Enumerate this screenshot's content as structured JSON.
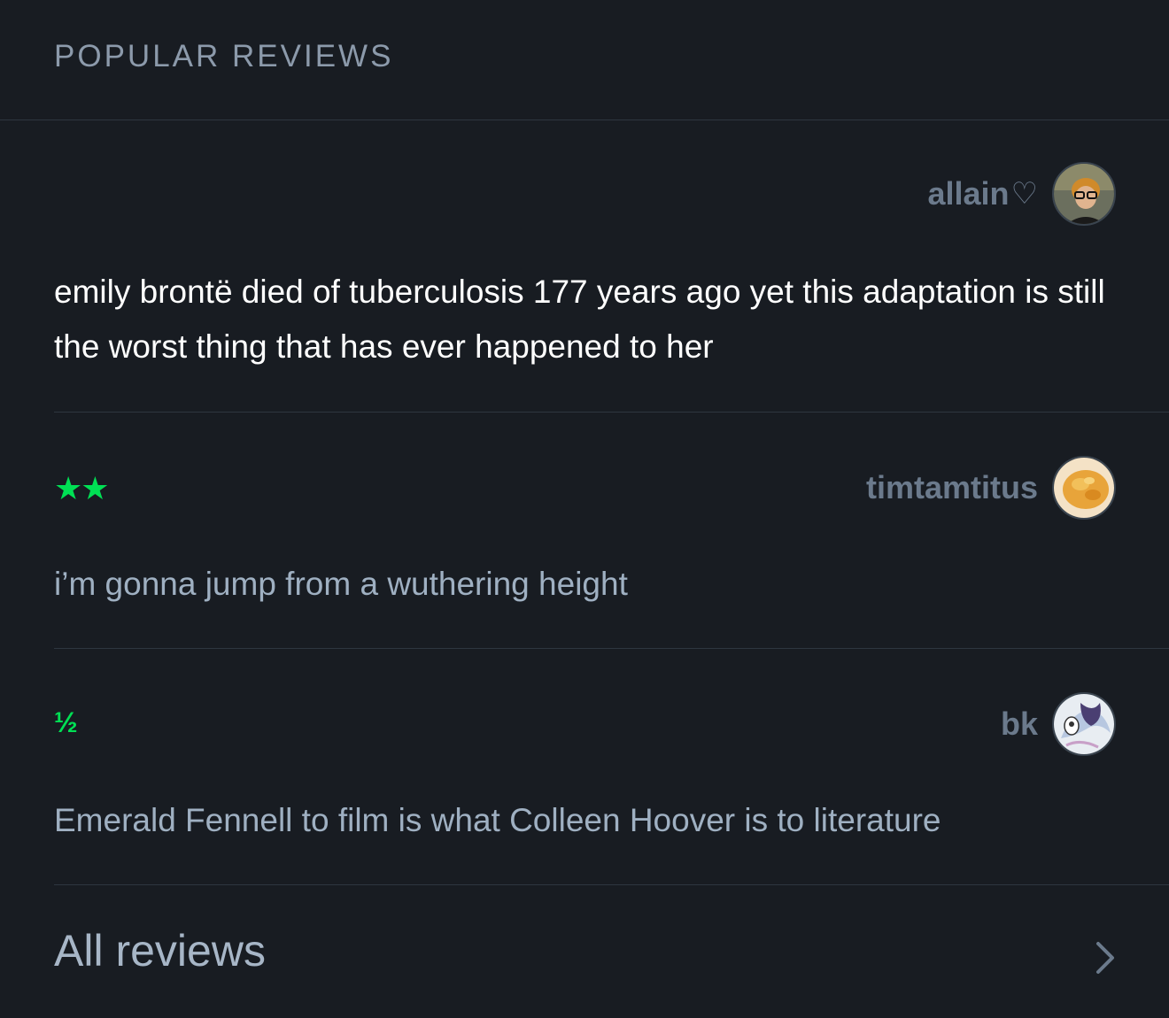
{
  "section": {
    "title": "POPULAR REVIEWS"
  },
  "reviews": [
    {
      "author": "allain",
      "heart": "♡",
      "rating": "",
      "text": "emily brontë died of tuberculosis 177 years ago yet this adaptation is still the worst thing that has ever happened to her"
    },
    {
      "author": "timtamtitus",
      "rating": "★★",
      "rating_value": 2,
      "text": "i’m gonna jump from a wuthering height"
    },
    {
      "author": "bk",
      "rating": "½",
      "rating_value": 0.5,
      "text": "Emerald Fennell to film is what Colleen Hoover is to literature"
    }
  ],
  "footer": {
    "all_reviews_label": "All reviews"
  },
  "colors": {
    "background": "#181c22",
    "star_green": "#00e054",
    "author_gray": "#6b7a8c"
  }
}
